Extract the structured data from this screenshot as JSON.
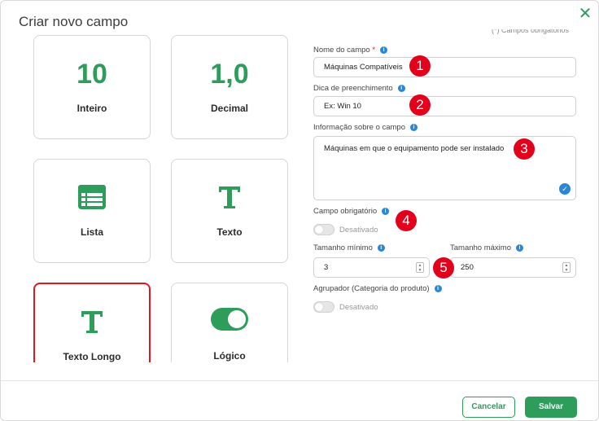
{
  "dialog": {
    "title": "Criar novo campo",
    "close_icon": "close-icon",
    "required_note": "(*) Campos obrigatórios"
  },
  "field_types": [
    {
      "big": "10",
      "label": "Inteiro",
      "icon": "integer-number"
    },
    {
      "big": "1,0",
      "label": "Decimal",
      "icon": "decimal-number"
    },
    {
      "big": "",
      "label": "Lista",
      "icon": "list-icon"
    },
    {
      "big": "",
      "label": "Texto",
      "icon": "text-icon"
    },
    {
      "big": "",
      "label": "Texto Longo",
      "icon": "text-icon",
      "selected": true
    },
    {
      "big": "",
      "label": "Lógico",
      "icon": "toggle-icon"
    }
  ],
  "form": {
    "name_label": "Nome do campo",
    "name_required_mark": "*",
    "name_value": "Máquinas Compatíveis",
    "hint_label": "Dica de preenchimento",
    "hint_value": "Ex: Win 10",
    "info_label": "Informação sobre o campo",
    "info_value": "Máquinas em que o equipamento pode ser instalado",
    "required_label": "Campo obrigatório",
    "required_state": "Desativado",
    "min_label": "Tamanho mínimo",
    "min_value": "3",
    "max_label": "Tamanho máximo",
    "max_value": "250",
    "group_label": "Agrupador (Categoria do produto)",
    "group_state": "Desativado"
  },
  "callouts": [
    "1",
    "2",
    "3",
    "4",
    "5"
  ],
  "footer": {
    "cancel_label": "Cancelar",
    "save_label": "Salvar"
  },
  "colors": {
    "accent": "#2e9c5b",
    "callout": "#e3001b",
    "info": "#2a86d6",
    "selected_border": "#e0171f"
  }
}
